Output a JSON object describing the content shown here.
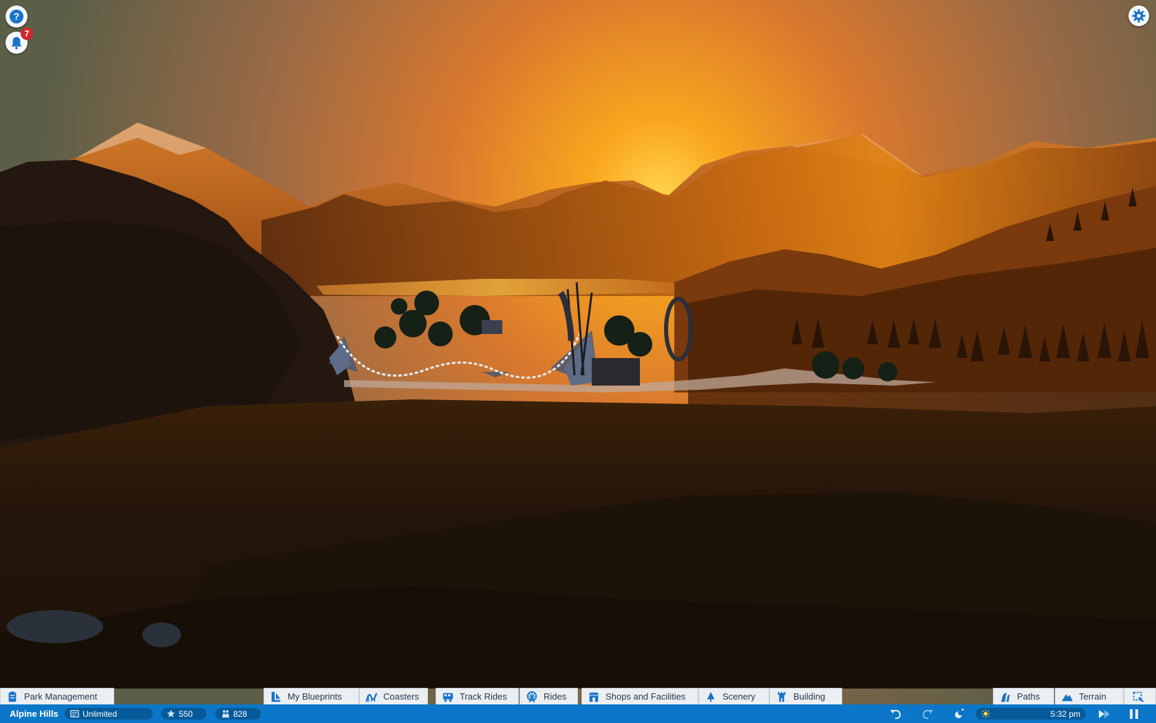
{
  "hud": {
    "notification_count": "7",
    "icons": [
      "help-icon",
      "bell-icon",
      "settings-gear-icon"
    ]
  },
  "toolbar": {
    "park_management": "Park Management",
    "tabs": [
      "My Blueprints",
      "Coasters",
      "Track Rides",
      "Rides",
      "Shops and Facilities",
      "Scenery",
      "Building"
    ],
    "right_tabs": [
      "Paths",
      "Terrain"
    ]
  },
  "status": {
    "park_name": "Alpine Hills",
    "money": "Unlimited",
    "rating": "550",
    "guests": "828",
    "time": "5:32 pm"
  },
  "colors": {
    "status_bar": "#0c77c8",
    "tab_background": "#eceff2",
    "tab_text": "#24384f",
    "badge": "#d3262e",
    "sky_glow": "#f59a1a"
  }
}
